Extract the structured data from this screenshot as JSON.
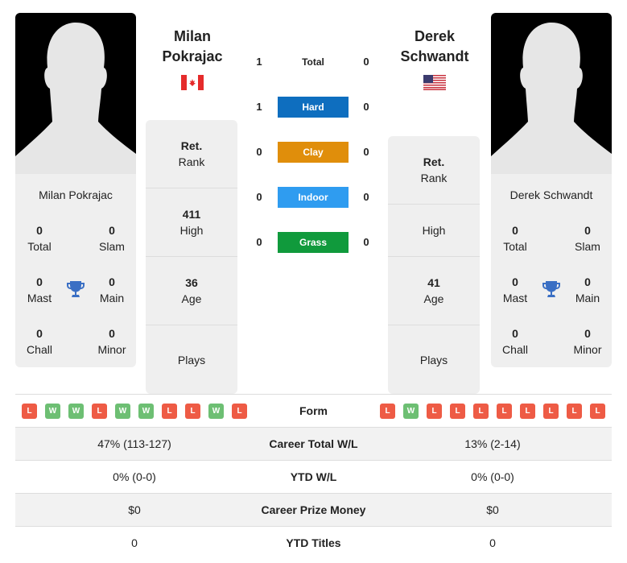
{
  "players": [
    {
      "name_header_line1": "Milan",
      "name_header_line2": "Pokrajac",
      "card_name": "Milan Pokrajac",
      "country": "Canada",
      "flag_icon": "canada-flag-icon",
      "titles": {
        "total": "0",
        "slam": "0",
        "mast": "0",
        "main": "0",
        "chall": "0",
        "minor": "0"
      },
      "stats": {
        "rank_value": "Ret.",
        "rank_label": "Rank",
        "high_value": "411",
        "high_label": "High",
        "age_value": "36",
        "age_label": "Age",
        "plays_value": "",
        "plays_label": "Plays"
      }
    },
    {
      "name_header_line1": "Derek",
      "name_header_line2": "Schwandt",
      "card_name": "Derek Schwandt",
      "country": "USA",
      "flag_icon": "usa-flag-icon",
      "titles": {
        "total": "0",
        "slam": "0",
        "mast": "0",
        "main": "0",
        "chall": "0",
        "minor": "0"
      },
      "stats": {
        "rank_value": "Ret.",
        "rank_label": "Rank",
        "high_value": "",
        "high_label": "High",
        "age_value": "41",
        "age_label": "Age",
        "plays_value": "",
        "plays_label": "Plays"
      }
    }
  ],
  "title_labels": {
    "total": "Total",
    "slam": "Slam",
    "mast": "Mast",
    "main": "Main",
    "chall": "Chall",
    "minor": "Minor"
  },
  "h2h": [
    {
      "label": "Total",
      "left": "1",
      "right": "0",
      "color": ""
    },
    {
      "label": "Hard",
      "left": "1",
      "right": "0",
      "color": "#0e6ebf"
    },
    {
      "label": "Clay",
      "left": "0",
      "right": "0",
      "color": "#e08e0b"
    },
    {
      "label": "Indoor",
      "left": "0",
      "right": "0",
      "color": "#2f9cf0"
    },
    {
      "label": "Grass",
      "left": "0",
      "right": "0",
      "color": "#109a3c"
    }
  ],
  "comparison": {
    "form_label": "Form",
    "form_left": [
      "L",
      "W",
      "W",
      "L",
      "W",
      "W",
      "L",
      "L",
      "W",
      "L"
    ],
    "form_right": [
      "L",
      "W",
      "L",
      "L",
      "L",
      "L",
      "L",
      "L",
      "L",
      "L"
    ],
    "rows": [
      {
        "label": "Career Total W/L",
        "left": "47% (113-127)",
        "right": "13% (2-14)"
      },
      {
        "label": "YTD W/L",
        "left": "0% (0-0)",
        "right": "0% (0-0)"
      },
      {
        "label": "Career Prize Money",
        "left": "$0",
        "right": "$0"
      },
      {
        "label": "YTD Titles",
        "left": "0",
        "right": "0"
      }
    ]
  }
}
